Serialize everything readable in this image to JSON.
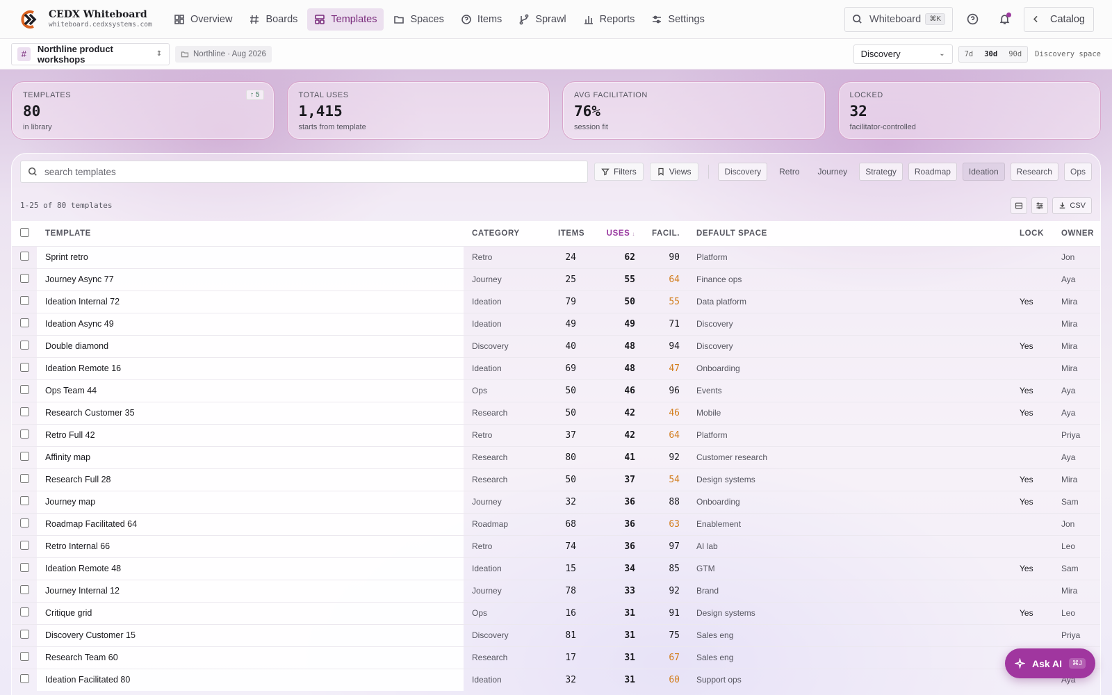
{
  "app": {
    "title": "CEDX Whiteboard",
    "url": "whiteboard.cedxsystems.com",
    "accent": "#a0369f"
  },
  "nav": {
    "items": [
      {
        "label": "Overview",
        "icon": "grid-icon"
      },
      {
        "label": "Boards",
        "icon": "hash-icon"
      },
      {
        "label": "Templates",
        "icon": "layout-icon",
        "active": true
      },
      {
        "label": "Spaces",
        "icon": "folder-icon"
      },
      {
        "label": "Items",
        "icon": "help-circle-icon"
      },
      {
        "label": "Sprawl",
        "icon": "branch-icon"
      },
      {
        "label": "Reports",
        "icon": "bar-chart-icon"
      },
      {
        "label": "Settings",
        "icon": "sliders-icon"
      }
    ],
    "search_label": "Whiteboard",
    "search_shortcut": "⌘K",
    "catalog_label": "Catalog"
  },
  "subbar": {
    "workspace_badge": "#",
    "workspace_name": "Northline product workshops",
    "period_tag": "Northline · Aug 2026",
    "space_select": "Discovery",
    "ranges": [
      "7d",
      "30d",
      "90d"
    ],
    "active_range": "30d",
    "space_caption": "Discovery space"
  },
  "kpis": [
    {
      "label": "TEMPLATES",
      "value": "80",
      "sub": "in library",
      "delta": "↑ 5"
    },
    {
      "label": "TOTAL USES",
      "value": "1,415",
      "sub": "starts from template"
    },
    {
      "label": "AVG FACILITATION",
      "value": "76%",
      "sub": "session fit"
    },
    {
      "label": "LOCKED",
      "value": "32",
      "sub": "facilitator-controlled"
    }
  ],
  "toolbar": {
    "search_placeholder": "search templates",
    "filters_label": "Filters",
    "views_label": "Views",
    "chips": [
      {
        "label": "Discovery",
        "style": "outlined"
      },
      {
        "label": "Retro",
        "style": "plain"
      },
      {
        "label": "Journey",
        "style": "plain"
      },
      {
        "label": "Strategy",
        "style": "outlined"
      },
      {
        "label": "Roadmap",
        "style": "outlined"
      },
      {
        "label": "Ideation",
        "style": "pressed"
      },
      {
        "label": "Research",
        "style": "outlined"
      },
      {
        "label": "Ops",
        "style": "outlined"
      }
    ],
    "count_text": "1-25 of 80 templates",
    "csv_label": "CSV"
  },
  "table": {
    "columns": {
      "template": "TEMPLATE",
      "category": "CATEGORY",
      "items": "ITEMS",
      "uses": "USES",
      "facil": "FACIL.",
      "space": "DEFAULT SPACE",
      "lock": "LOCK",
      "owner": "OWNER"
    },
    "sort_marker": "↓",
    "low_facil_color": "#d27d1c",
    "rows": [
      {
        "name": "Sprint retro",
        "category": "Retro",
        "items": "24",
        "uses": "62",
        "facil": "90",
        "space": "Platform",
        "lock": "",
        "owner": "Jon"
      },
      {
        "name": "Journey Async 77",
        "category": "Journey",
        "items": "25",
        "uses": "55",
        "facil": "64",
        "space": "Finance ops",
        "lock": "",
        "owner": "Aya"
      },
      {
        "name": "Ideation Internal 72",
        "category": "Ideation",
        "items": "79",
        "uses": "50",
        "facil": "55",
        "space": "Data platform",
        "lock": "Yes",
        "owner": "Mira"
      },
      {
        "name": "Ideation Async 49",
        "category": "Ideation",
        "items": "49",
        "uses": "49",
        "facil": "71",
        "space": "Discovery",
        "lock": "",
        "owner": "Mira"
      },
      {
        "name": "Double diamond",
        "category": "Discovery",
        "items": "40",
        "uses": "48",
        "facil": "94",
        "space": "Discovery",
        "lock": "Yes",
        "owner": "Mira"
      },
      {
        "name": "Ideation Remote 16",
        "category": "Ideation",
        "items": "69",
        "uses": "48",
        "facil": "47",
        "space": "Onboarding",
        "lock": "",
        "owner": "Mira"
      },
      {
        "name": "Ops Team 44",
        "category": "Ops",
        "items": "50",
        "uses": "46",
        "facil": "96",
        "space": "Events",
        "lock": "Yes",
        "owner": "Aya"
      },
      {
        "name": "Research Customer 35",
        "category": "Research",
        "items": "50",
        "uses": "42",
        "facil": "46",
        "space": "Mobile",
        "lock": "Yes",
        "owner": "Aya"
      },
      {
        "name": "Retro Full 42",
        "category": "Retro",
        "items": "37",
        "uses": "42",
        "facil": "64",
        "space": "Platform",
        "lock": "",
        "owner": "Priya"
      },
      {
        "name": "Affinity map",
        "category": "Research",
        "items": "80",
        "uses": "41",
        "facil": "92",
        "space": "Customer research",
        "lock": "",
        "owner": "Aya"
      },
      {
        "name": "Research Full 28",
        "category": "Research",
        "items": "50",
        "uses": "37",
        "facil": "54",
        "space": "Design systems",
        "lock": "Yes",
        "owner": "Mira"
      },
      {
        "name": "Journey map",
        "category": "Journey",
        "items": "32",
        "uses": "36",
        "facil": "88",
        "space": "Onboarding",
        "lock": "Yes",
        "owner": "Sam"
      },
      {
        "name": "Roadmap Facilitated 64",
        "category": "Roadmap",
        "items": "68",
        "uses": "36",
        "facil": "63",
        "space": "Enablement",
        "lock": "",
        "owner": "Jon"
      },
      {
        "name": "Retro Internal 66",
        "category": "Retro",
        "items": "74",
        "uses": "36",
        "facil": "97",
        "space": "AI lab",
        "lock": "",
        "owner": "Leo"
      },
      {
        "name": "Ideation Remote 48",
        "category": "Ideation",
        "items": "15",
        "uses": "34",
        "facil": "85",
        "space": "GTM",
        "lock": "Yes",
        "owner": "Sam"
      },
      {
        "name": "Journey Internal 12",
        "category": "Journey",
        "items": "78",
        "uses": "33",
        "facil": "92",
        "space": "Brand",
        "lock": "",
        "owner": "Mira"
      },
      {
        "name": "Critique grid",
        "category": "Ops",
        "items": "16",
        "uses": "31",
        "facil": "91",
        "space": "Design systems",
        "lock": "Yes",
        "owner": "Leo"
      },
      {
        "name": "Discovery Customer 15",
        "category": "Discovery",
        "items": "81",
        "uses": "31",
        "facil": "75",
        "space": "Sales eng",
        "lock": "",
        "owner": "Priya"
      },
      {
        "name": "Research Team 60",
        "category": "Research",
        "items": "17",
        "uses": "31",
        "facil": "67",
        "space": "Sales eng",
        "lock": "",
        "owner": ""
      },
      {
        "name": "Ideation Facilitated 80",
        "category": "Ideation",
        "items": "32",
        "uses": "31",
        "facil": "60",
        "space": "Support ops",
        "lock": "",
        "owner": "Aya"
      }
    ]
  },
  "ask_ai": {
    "label": "Ask AI",
    "shortcut": "⌘J"
  }
}
